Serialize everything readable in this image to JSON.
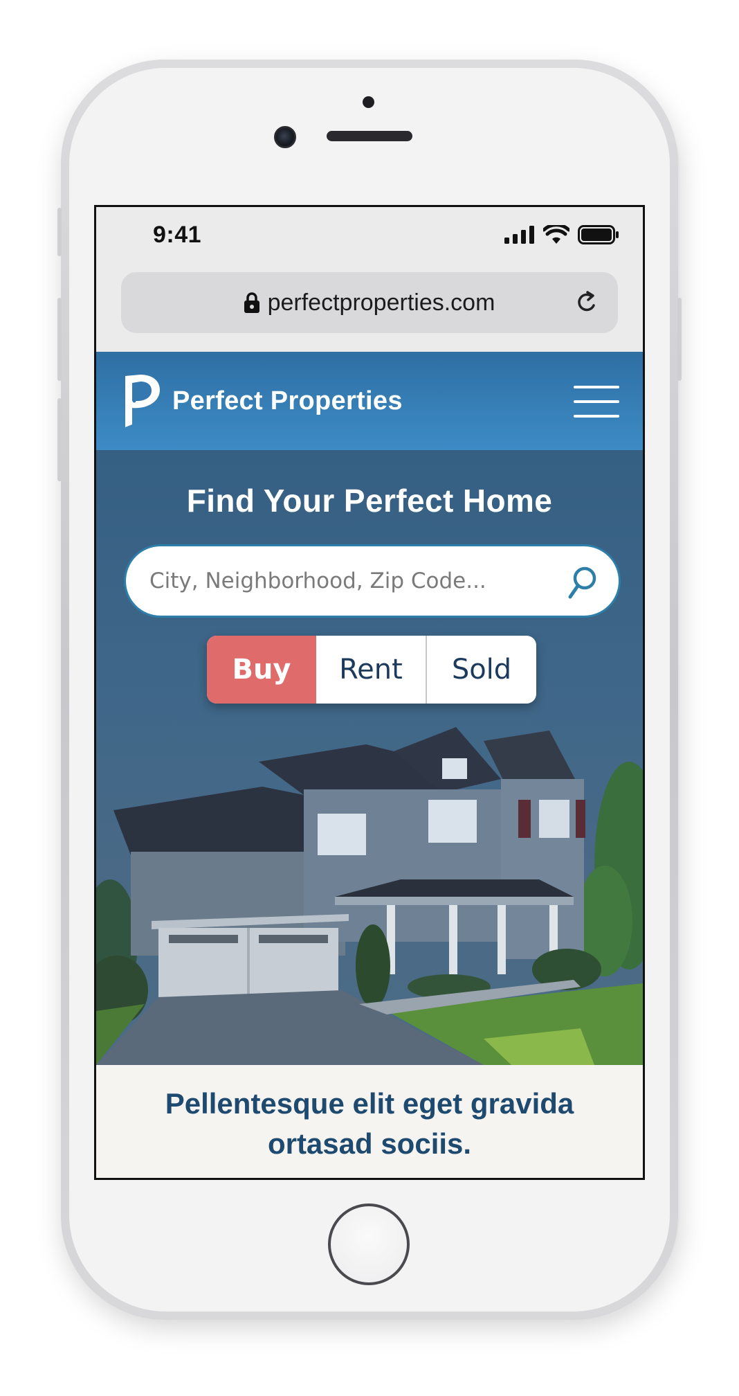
{
  "status_bar": {
    "time": "9:41",
    "icons": [
      "signal-icon",
      "wifi-icon",
      "battery-icon"
    ]
  },
  "browser": {
    "url": "perfectproperties.com",
    "icons": [
      "lock-icon",
      "reload-icon"
    ]
  },
  "site": {
    "brand_name": "Perfect Properties",
    "brand_color": "#3d8bc6",
    "menu_icon": "hamburger-menu-icon"
  },
  "hero": {
    "title": "Find Your Perfect Home",
    "search": {
      "placeholder": "City, Neighborhood, Zip Code...",
      "value": "",
      "icon": "search-icon"
    },
    "listing_type": {
      "options": [
        "Buy",
        "Rent",
        "Sold"
      ],
      "selected": "Buy",
      "selected_color": "#e06b6b"
    }
  },
  "tagline": "Pellentesque elit eget gravida ortasad sociis."
}
